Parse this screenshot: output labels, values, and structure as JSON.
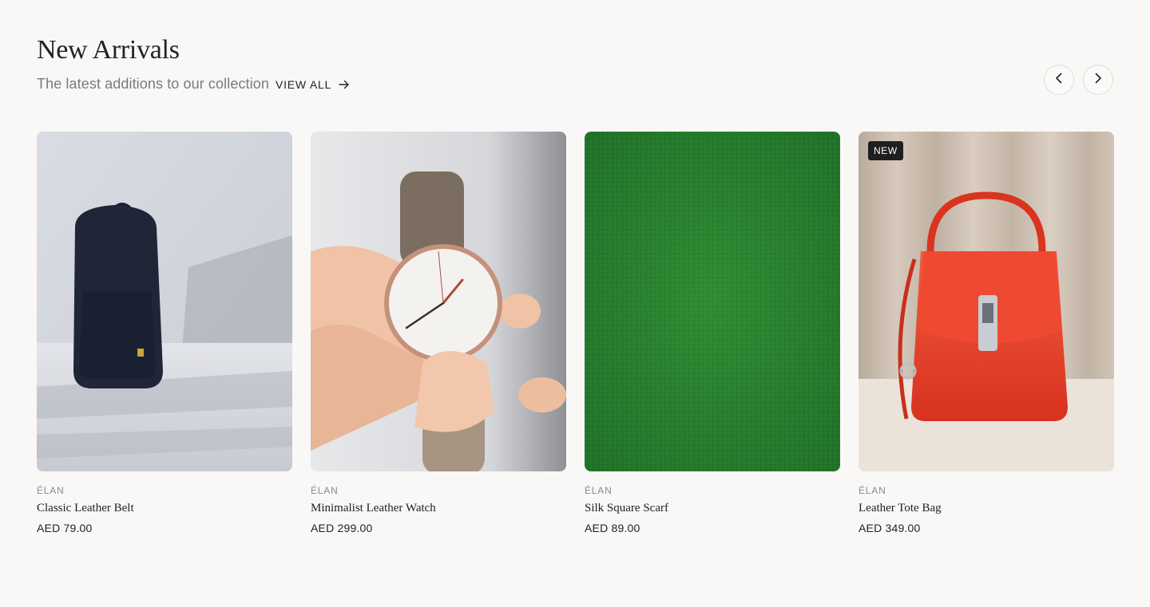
{
  "header": {
    "title": "New Arrivals",
    "subtitle": "The latest additions to our collection",
    "view_all_label": "VIEW ALL",
    "view_all_icon": "arrow-right-icon"
  },
  "carousel": {
    "prev_icon": "chevron-left-icon",
    "next_icon": "chevron-right-icon"
  },
  "products": [
    {
      "brand": "ÉLAN",
      "name": "Classic Leather Belt",
      "price": "AED 79.00",
      "badge": "",
      "image": "navy backpack"
    },
    {
      "brand": "ÉLAN",
      "name": "Minimalist Leather Watch",
      "price": "AED 299.00",
      "badge": "",
      "image": "hand holding watch"
    },
    {
      "brand": "ÉLAN",
      "name": "Silk Square Scarf",
      "price": "AED 89.00",
      "badge": "",
      "image": "green fabric texture"
    },
    {
      "brand": "ÉLAN",
      "name": "Leather Tote Bag",
      "price": "AED 349.00",
      "badge": "NEW",
      "image": "red leather handbag"
    }
  ],
  "colors": {
    "background": "#f9f8f6",
    "text": "#222222",
    "muted": "#7a7a7a",
    "badge_bg": "#1f1f1f"
  }
}
